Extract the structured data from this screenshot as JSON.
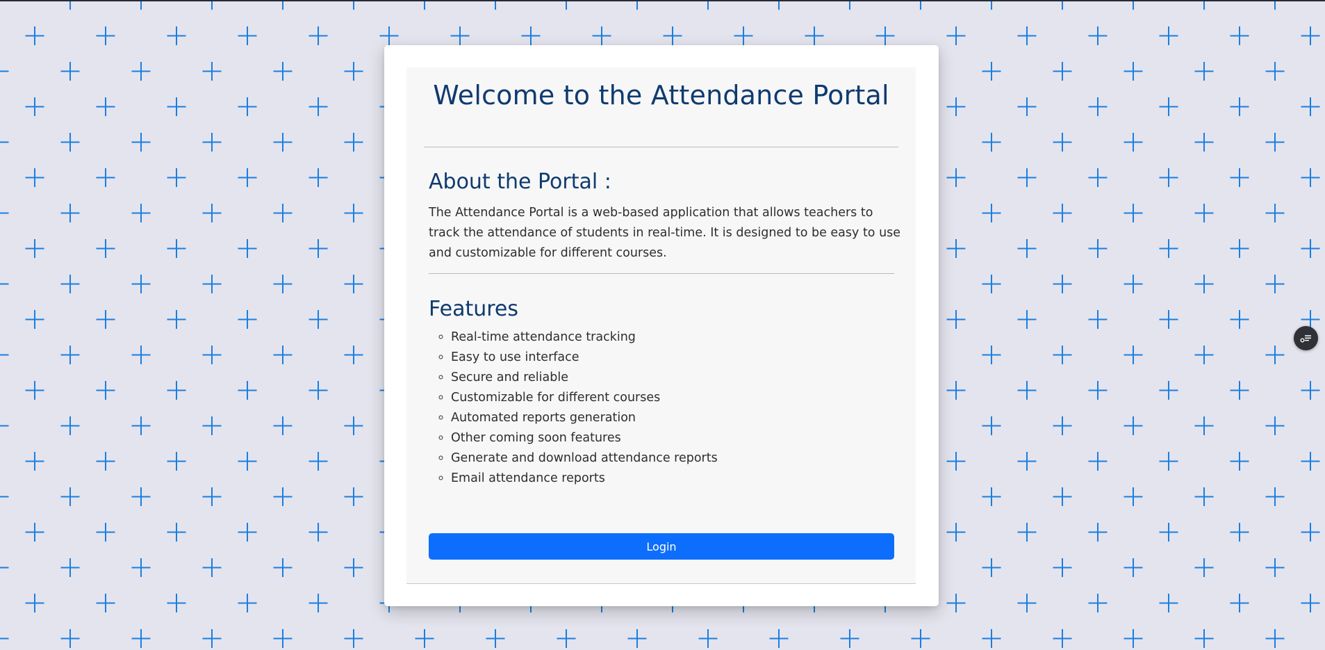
{
  "page": {
    "title": "Welcome to the Attendance Portal",
    "background_color": "#e4e4ee",
    "pattern_color": "#1a7ee0",
    "heading_color": "#0f3a6e"
  },
  "about": {
    "heading": "About the Portal :",
    "text": "The Attendance Portal is a web-based application that allows teachers to track the attendance of students in real-time. It is designed to be easy to use and customizable for different courses."
  },
  "features": {
    "heading": "Features",
    "items": [
      "Real-time attendance tracking",
      "Easy to use interface",
      "Secure and reliable",
      "Customizable for different courses",
      "Automated reports generation",
      "Other coming soon features",
      "Generate and download attendance reports",
      "Email attendance reports"
    ]
  },
  "login": {
    "label": "Login",
    "color": "#0d6efd"
  },
  "widget": {
    "icon": "toggle-list-icon"
  }
}
